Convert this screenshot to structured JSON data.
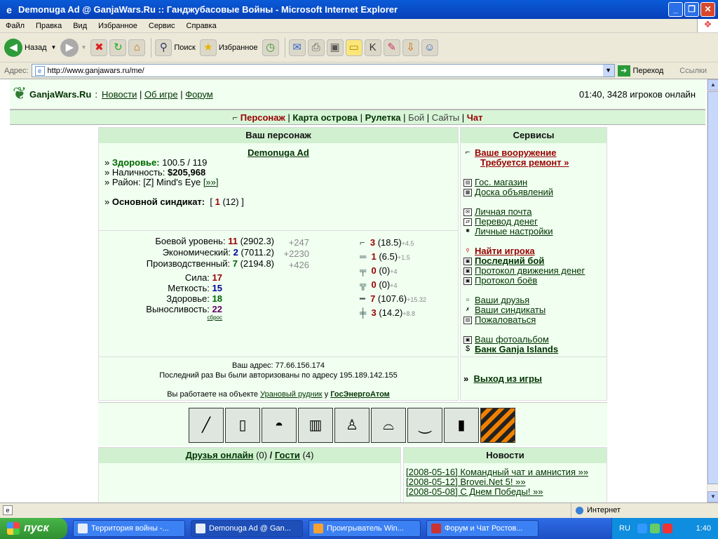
{
  "window": {
    "title": "Demonuga Ad @ GanjaWars.Ru :: Ганджубасовые Войны - Microsoft Internet Explorer"
  },
  "menu": [
    "Файл",
    "Правка",
    "Вид",
    "Избранное",
    "Сервис",
    "Справка"
  ],
  "toolbar": {
    "back": "Назад",
    "search": "Поиск",
    "favorites": "Избранное"
  },
  "address": {
    "label": "Адрес:",
    "url": "http://www.ganjawars.ru/me/",
    "go": "Переход",
    "links": "Ссылки"
  },
  "header": {
    "site": "GanjaWars.Ru",
    "sep": ":",
    "nav": [
      "Новости",
      "Об игре",
      "Форум"
    ],
    "online": "01:40, 3428 игроков онлайн"
  },
  "nav2": {
    "items": [
      "Персонаж",
      "Карта острова",
      "Рулетка",
      "Бой",
      "Сайты",
      "Чат"
    ]
  },
  "character": {
    "heading": "Ваш персонаж",
    "name": "Demonuga Ad",
    "health_label": "Здоровье:",
    "health_value": "100.5 / 119",
    "cash_label": "Наличность:",
    "cash_value": "$205,968",
    "district_label": "Район:",
    "district_value": "[Z] Mind's Eye",
    "district_link": "[»»]",
    "syndicate_label": "Основной синдикат:",
    "syndicate_open": "[",
    "syndicate_num": "1",
    "syndicate_rest": "(12) ]"
  },
  "levels": [
    {
      "label": "Боевой уровень:",
      "level": "11",
      "exp": "(2902.3)",
      "gain": "+247"
    },
    {
      "label": "Экономический:",
      "level": "2",
      "exp": "(7011.2)",
      "gain": "+2230"
    },
    {
      "label": "Производственный:",
      "level": "7",
      "exp": "(2194.8)",
      "gain": "+426"
    }
  ],
  "attributes": [
    {
      "label": "Сила:",
      "value": "17"
    },
    {
      "label": "Меткость:",
      "value": "15"
    },
    {
      "label": "Здоровье:",
      "value": "18"
    },
    {
      "label": "Выносливость:",
      "value": "22"
    }
  ],
  "reset": "сброс",
  "weapons": [
    {
      "level": "3",
      "exp": "(18.5)",
      "gain": "+4.5"
    },
    {
      "level": "1",
      "exp": "(6.5)",
      "gain": "+1.5"
    },
    {
      "level": "0",
      "exp": "(0)",
      "gain": "+4"
    },
    {
      "level": "0",
      "exp": "(0)",
      "gain": "+4"
    },
    {
      "level": "7",
      "exp": "(107.6)",
      "gain": "+15.32"
    },
    {
      "level": "3",
      "exp": "(14.2)",
      "gain": "+8.8"
    }
  ],
  "ip": {
    "address": "Ваш адрес: 77.66.156.174",
    "last": "Последний раз Вы были авторизованы по адресу 195.189.142.155",
    "work_prefix": "Вы работаете на объекте",
    "work_object": "Урановый рудник",
    "work_mid": "у",
    "work_owner": "ГосЭнергоАтом"
  },
  "services": {
    "heading": "Сервисы",
    "weapon": "Ваше вооружение",
    "repair": "Требуется ремонт »",
    "items": [
      "Гос. магазин",
      "Доска объявлений",
      "Личная почта",
      "Перевод денег",
      "Личные настройки",
      "Найти игрока",
      "Последний бой",
      "Протокол движения денег",
      "Протокол боёв",
      "Ваши друзья",
      "Ваши синдикаты",
      "Пожаловаться",
      "Ваш фотоальбом",
      "Банк Ganja Islands"
    ],
    "exit_prefix": "»",
    "exit": "Выход из игры"
  },
  "friends": {
    "label": "Друзья онлайн",
    "count": "(0)",
    "slash": "/",
    "guests": "Гости",
    "guests_count": "(4)"
  },
  "news": {
    "heading": "Новости",
    "items": [
      "[2008-05-16] Командный чат и амнистия »»",
      "[2008-05-12] Brovei.Net 5! »»",
      "[2008-05-08] С Днем Победы! »»"
    ]
  },
  "status": {
    "zone": "Интернет"
  },
  "taskbar": {
    "start": "пуск",
    "tasks": [
      "Территория войны -...",
      "Demonuga Ad @ Gan...",
      "Проигрыватель Win...",
      "Форум и Чат Ростов..."
    ],
    "lang": "RU",
    "clock": "1:40"
  },
  "colors": {
    "accent": "#990000",
    "link": "#003300",
    "panel": "#f0fff0"
  }
}
